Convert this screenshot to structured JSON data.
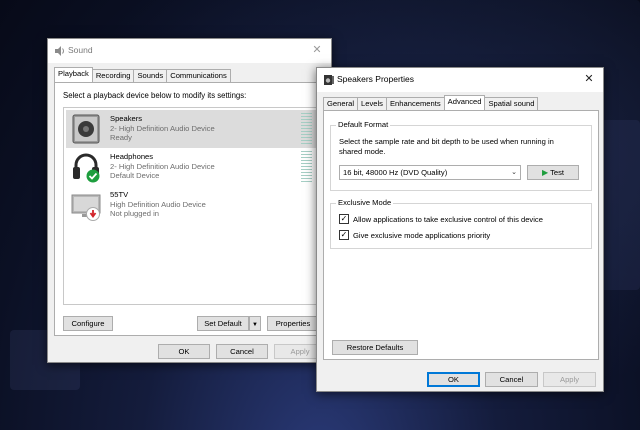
{
  "sound": {
    "title": "Sound",
    "tabs": [
      "Playback",
      "Recording",
      "Sounds",
      "Communications"
    ],
    "instruction": "Select a playback device below to modify its settings:",
    "devices": [
      {
        "name": "Speakers",
        "sub": "2- High Definition Audio Device",
        "status": "Ready",
        "icon": "speaker-icon"
      },
      {
        "name": "Headphones",
        "sub": "2- High Definition Audio Device",
        "status": "Default Device",
        "icon": "headphones-icon"
      },
      {
        "name": "55TV",
        "sub": "High Definition Audio Device",
        "status": "Not plugged in",
        "icon": "tv-icon"
      }
    ],
    "buttons": {
      "configure": "Configure",
      "set_default": "Set Default",
      "properties": "Properties",
      "ok": "OK",
      "cancel": "Cancel",
      "apply": "Apply"
    }
  },
  "speakers_properties": {
    "title": "Speakers Properties",
    "tabs": [
      "General",
      "Levels",
      "Enhancements",
      "Advanced",
      "Spatial sound"
    ],
    "active_tab": "Advanced",
    "default_format": {
      "label": "Default Format",
      "description": "Select the sample rate and bit depth to be used when running in shared mode.",
      "selected": "16 bit, 48000 Hz (DVD Quality)",
      "test_label": "Test"
    },
    "exclusive_mode": {
      "label": "Exclusive Mode",
      "options": [
        {
          "label": "Allow applications to take exclusive control of this device",
          "checked": true
        },
        {
          "label": "Give exclusive mode applications priority",
          "checked": true
        }
      ]
    },
    "buttons": {
      "restore_defaults": "Restore Defaults",
      "ok": "OK",
      "cancel": "Cancel",
      "apply": "Apply"
    }
  },
  "colors": {
    "accent": "#0078d7",
    "meter": "#a6cfc5",
    "default_check": "#1e9e3e",
    "unplugged": "#d2242a"
  }
}
